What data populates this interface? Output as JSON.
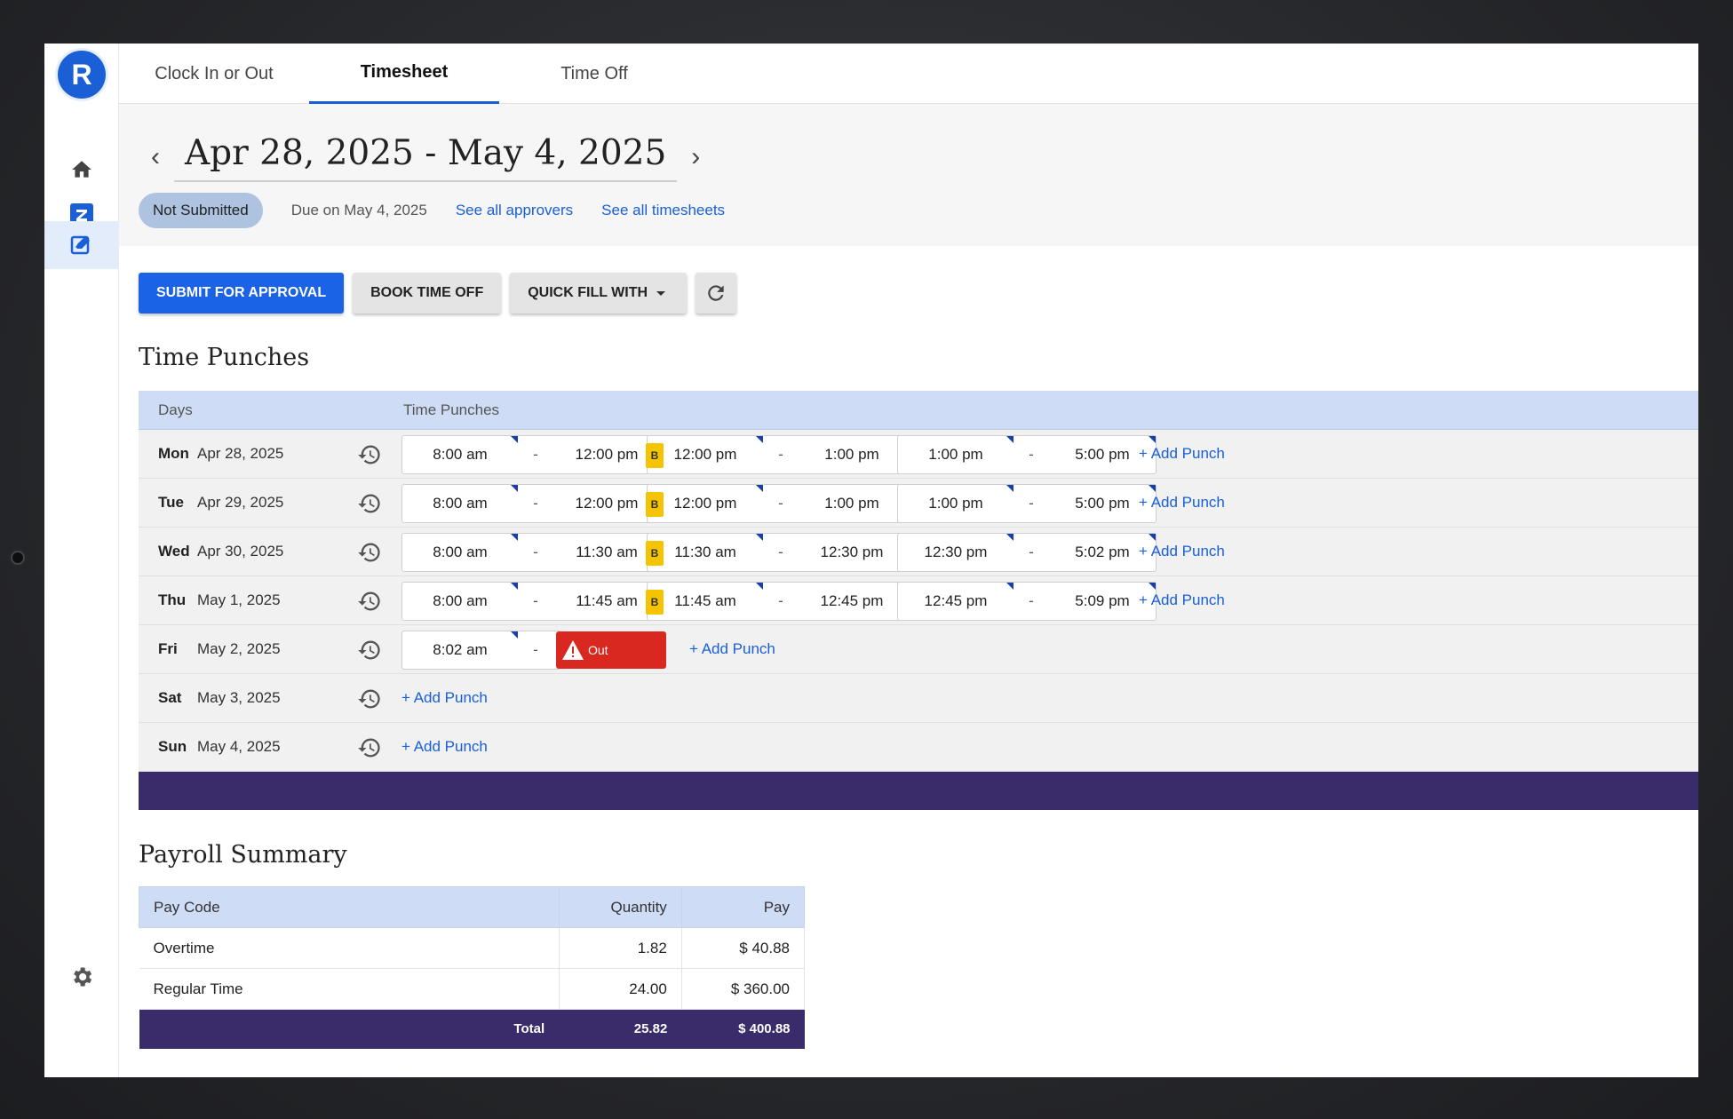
{
  "app": {
    "logo_letter": "R",
    "accent": "#1a5fd6",
    "footer_color": "#3a2b6b"
  },
  "rail": {
    "items": [
      {
        "name": "home",
        "icon": "home-icon"
      },
      {
        "name": "z-app",
        "icon": "z-logo-icon"
      },
      {
        "name": "timesheet",
        "icon": "edit-note-icon",
        "active": true
      }
    ],
    "settings_icon": "gear-icon"
  },
  "tabs": [
    {
      "label": "Clock In or Out"
    },
    {
      "label": "Timesheet",
      "active": true
    },
    {
      "label": "Time Off"
    }
  ],
  "period": {
    "range": "Apr 28, 2025 - May 4, 2025",
    "status": "Not Submitted",
    "due": "Due on May 4, 2025",
    "approvers_link": "See all approvers",
    "timesheets_link": "See all timesheets"
  },
  "toolbar": {
    "submit": "SUBMIT FOR APPROVAL",
    "book": "BOOK TIME OFF",
    "quickfill": "QUICK FILL WITH"
  },
  "time_punches": {
    "title": "Time Punches",
    "col_days": "Days",
    "col_punches": "Time Punches",
    "add_label": "+ Add Punch",
    "break_badge": "B",
    "out_label": "Out",
    "rows": [
      {
        "day": "Mon",
        "date": "Apr 28, 2025",
        "p1_in": "8:00 am",
        "p1_out": "12:00 pm",
        "p2_in": "12:00 pm",
        "p2_out": "1:00 pm",
        "p3_in": "1:00 pm",
        "p3_out": "5:00 pm"
      },
      {
        "day": "Tue",
        "date": "Apr 29, 2025",
        "p1_in": "8:00 am",
        "p1_out": "12:00 pm",
        "p2_in": "12:00 pm",
        "p2_out": "1:00 pm",
        "p3_in": "1:00 pm",
        "p3_out": "5:00 pm"
      },
      {
        "day": "Wed",
        "date": "Apr 30, 2025",
        "p1_in": "8:00 am",
        "p1_out": "11:30 am",
        "p2_in": "11:30 am",
        "p2_out": "12:30 pm",
        "p3_in": "12:30 pm",
        "p3_out": "5:02 pm"
      },
      {
        "day": "Thu",
        "date": "May 1, 2025",
        "p1_in": "8:00 am",
        "p1_out": "11:45 am",
        "p2_in": "11:45 am",
        "p2_out": "12:45 pm",
        "p3_in": "12:45 pm",
        "p3_out": "5:09 pm"
      },
      {
        "day": "Fri",
        "date": "May 2, 2025",
        "p1_in": "8:02 am"
      },
      {
        "day": "Sat",
        "date": "May 3, 2025"
      },
      {
        "day": "Sun",
        "date": "May 4, 2025"
      }
    ]
  },
  "payroll": {
    "title": "Payroll Summary",
    "headers": {
      "code": "Pay Code",
      "qty": "Quantity",
      "pay": "Pay"
    },
    "rows": [
      {
        "code": "Overtime",
        "qty": "1.82",
        "pay": "$ 40.88"
      },
      {
        "code": "Regular Time",
        "qty": "24.00",
        "pay": "$ 360.00"
      }
    ],
    "total": {
      "label": "Total",
      "qty": "25.82",
      "pay": "$ 400.88"
    }
  }
}
